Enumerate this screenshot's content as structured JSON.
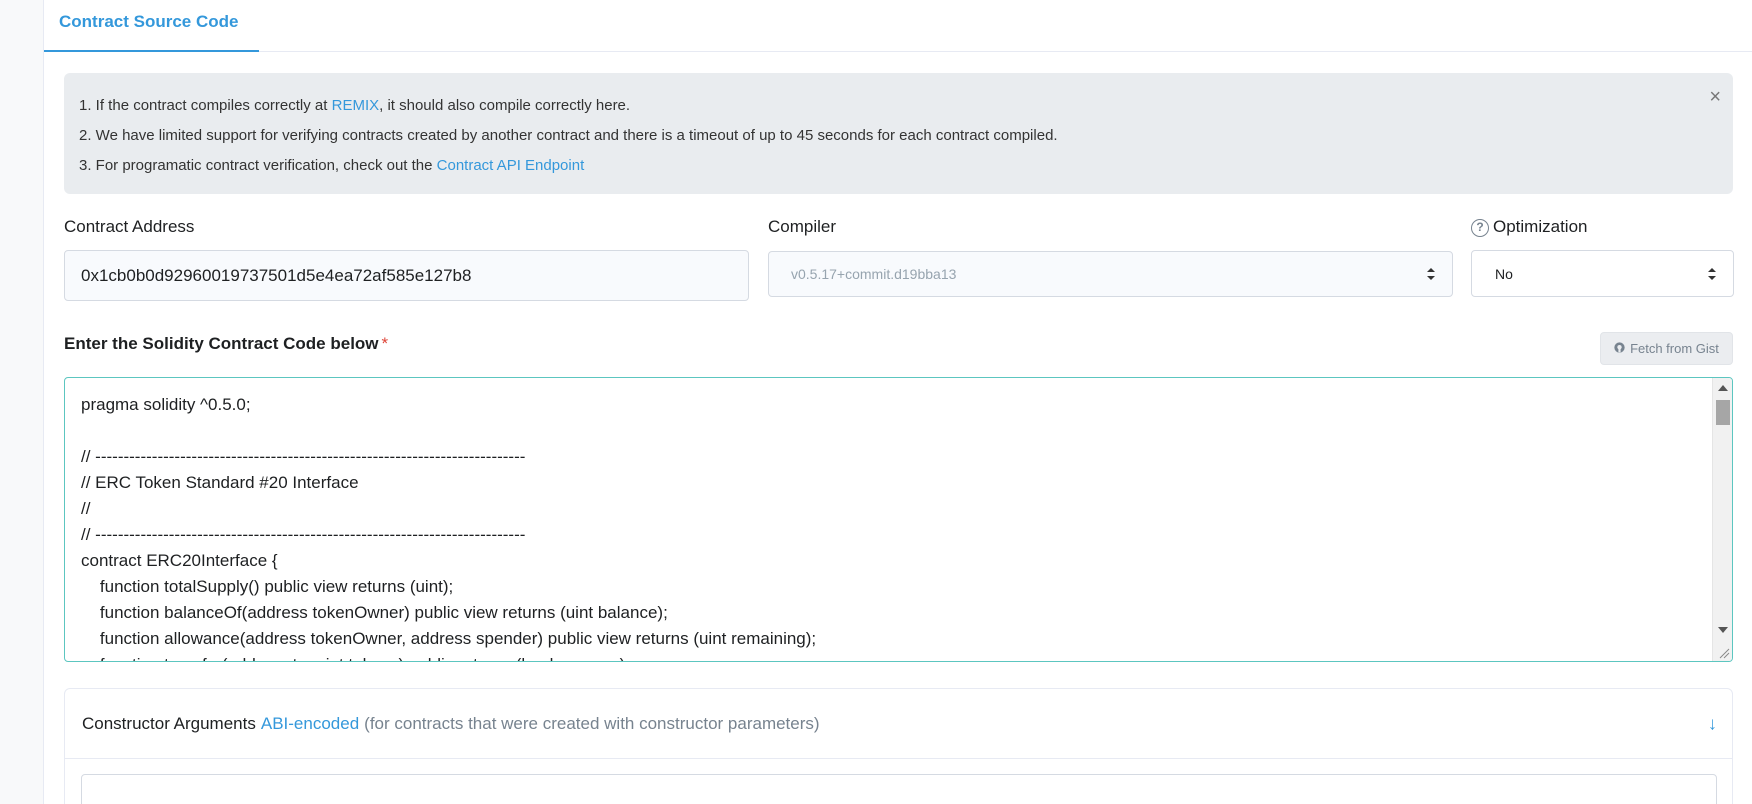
{
  "tab": {
    "label": "Contract Source Code"
  },
  "notice": {
    "line1_prefix": "1. If the contract compiles correctly at ",
    "line1_link": "REMIX",
    "line1_suffix": ", it should also compile correctly here.",
    "line2": "2. We have limited support for verifying contracts created by another contract and there is a timeout of up to 45 seconds for each contract compiled.",
    "line3_prefix": "3. For programatic contract verification, check out the ",
    "line3_link": "Contract API Endpoint",
    "close_symbol": "×"
  },
  "contract_address": {
    "label": "Contract Address",
    "value": "0x1cb0b0d92960019737501d5e4ea72af585e127b8"
  },
  "compiler": {
    "label": "Compiler",
    "value": "v0.5.17+commit.d19bba13"
  },
  "optimization": {
    "help_symbol": "?",
    "label": "Optimization",
    "value": "No"
  },
  "code_section": {
    "heading": "Enter the Solidity Contract Code below",
    "required_mark": "*",
    "gist_button": "Fetch from Gist",
    "lines": [
      "pragma solidity ^0.5.0;",
      "",
      "// ----------------------------------------------------------------------------",
      "// ERC Token Standard #20 Interface",
      "//",
      "// ----------------------------------------------------------------------------",
      "contract ERC20Interface {",
      "    function totalSupply() public view returns (uint);",
      "    function balanceOf(address tokenOwner) public view returns (uint balance);",
      "    function allowance(address tokenOwner, address spender) public view returns (uint remaining);",
      "    function transfer(address to, uint tokens) public returns (bool success);"
    ]
  },
  "constructor_args": {
    "prefix": "Constructor Arguments",
    "link": "ABI-encoded",
    "suffix": "(for contracts that were created with constructor parameters)",
    "arrow_symbol": "↓"
  },
  "colors": {
    "accent": "#3498db",
    "notice_bg": "#e9ecef",
    "code_border": "#5cc6c0",
    "required": "#de4437"
  }
}
